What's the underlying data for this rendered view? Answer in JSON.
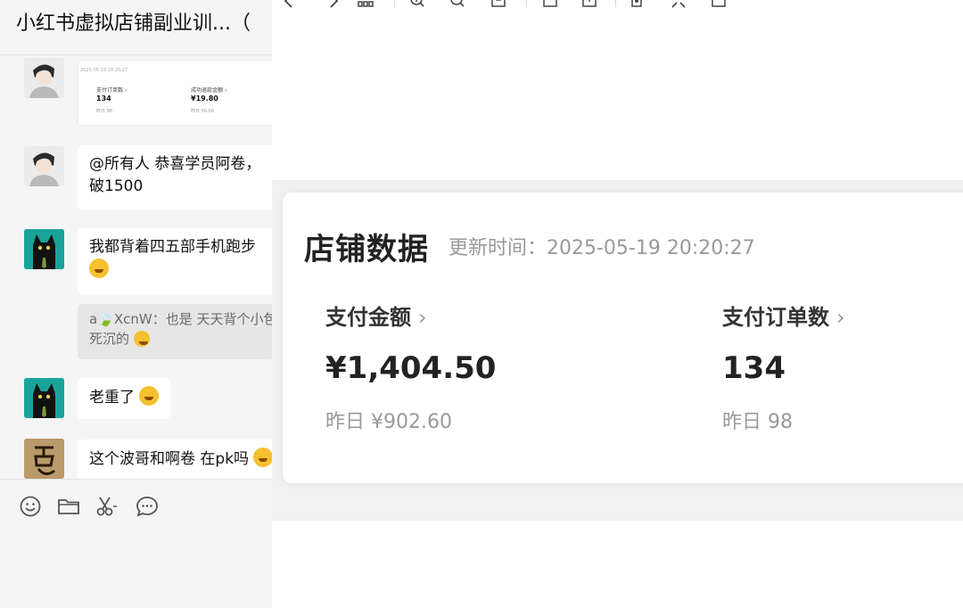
{
  "chat": {
    "title": "小红书虚拟店铺副业训...（",
    "messages": [
      {
        "sender": "person",
        "card": {
          "timestamp": "2025-05-19 20:20:27",
          "m1_label": "支付订单数 ›",
          "m1_value": "134",
          "m1_yesterday": "昨日 98",
          "m2_label": "成功退款金额 ›",
          "m2_value": "¥19.80",
          "m2_yesterday": "昨日 ¥0.00"
        }
      },
      {
        "sender": "person",
        "line1": "@所有人 恭喜学员阿卷，",
        "line2": "破1500"
      },
      {
        "sender": "cat",
        "line1": "我都背着四五部手机跑步"
      },
      {
        "quote_line1": "a🍃XcnW：也是 天天背个小包",
        "quote_line2": "死沉的"
      },
      {
        "sender": "cat",
        "text": "老重了"
      },
      {
        "sender": "calligraphy",
        "text": "这个波哥和啊卷 在pk吗"
      }
    ],
    "toolbar": [
      "emoji-icon",
      "folder-icon",
      "scissors-icon",
      "chat-bubble-icon"
    ]
  },
  "viewer": {
    "toolbar_icons": [
      "back-icon",
      "forward-icon",
      "grid-icon",
      "zoom-in-icon",
      "zoom-out-icon",
      "fit-icon",
      "crop-icon",
      "save-icon",
      "rotate-icon",
      "expand-icon",
      "copy-icon"
    ],
    "screenshot": {
      "title": "店铺数据",
      "update_time": "更新时间：2025-05-19 20:20:27",
      "metrics": [
        {
          "label": "支付金额",
          "value": "¥1,404.50",
          "yesterday": "昨日 ¥902.60"
        },
        {
          "label": "支付订单数",
          "value": "134",
          "yesterday": "昨日 98"
        }
      ]
    }
  },
  "colors": {
    "chat_bg": "#f5f5f5",
    "bubble_bg": "#ffffff",
    "quote_bg": "#e6e6e6",
    "cat_avatar": "#1aa39a",
    "muted_text": "#9a9a9a"
  }
}
